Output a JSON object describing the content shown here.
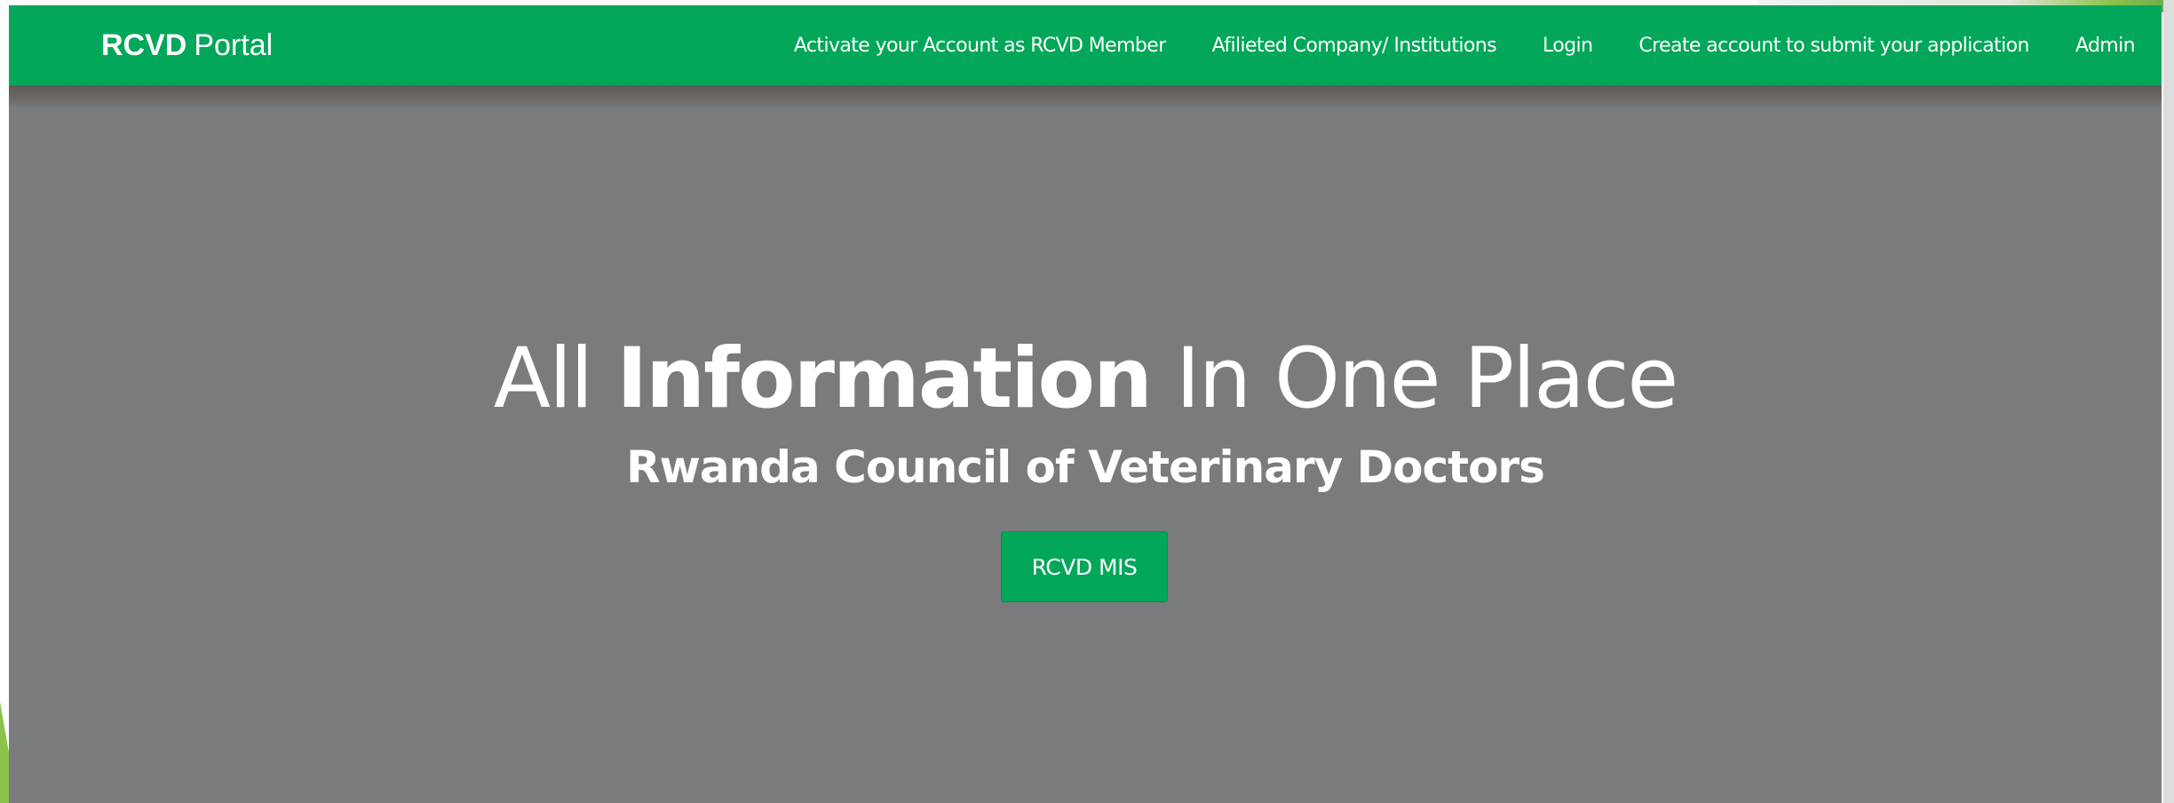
{
  "navbar": {
    "brand_strong": "RCVD",
    "brand_rest": "Portal",
    "links": [
      {
        "label": "Activate your Account as RCVD Member"
      },
      {
        "label": "Afilieted Company/ Institutions"
      },
      {
        "label": "Login"
      },
      {
        "label": "Create account to submit your application"
      },
      {
        "label": "Admin"
      }
    ]
  },
  "hero": {
    "title_prefix": "All",
    "title_strong": "Information",
    "title_suffix": "In One Place",
    "subtitle": "Rwanda Council of Veterinary Doctors",
    "cta_label": "RCVD MIS"
  },
  "colors": {
    "brand_green": "#02a75a",
    "hero_background": "#7a7b7d",
    "text_white": "#ffffff"
  }
}
